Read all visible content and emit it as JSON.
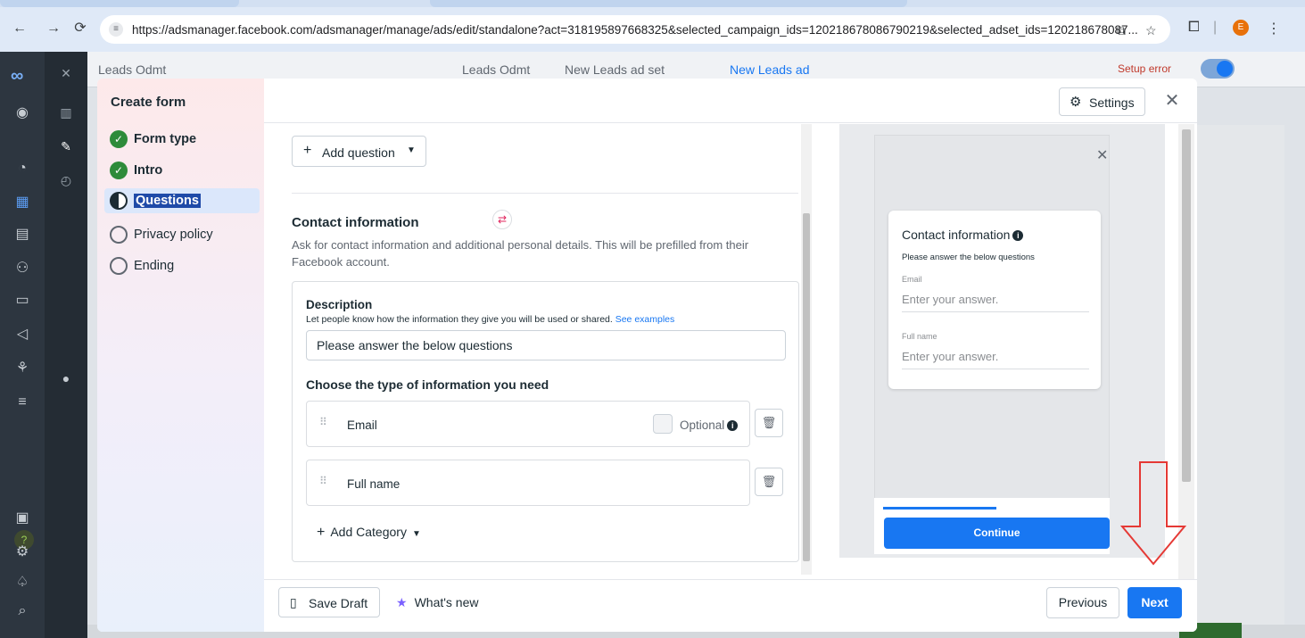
{
  "browser": {
    "url": "https://adsmanager.facebook.com/adsmanager/manage/ads/edit/standalone?act=318195897668325&selected_campaign_ids=120218678086790219&selected_adset_ids=120218678087...",
    "profile_initial": "E"
  },
  "background": {
    "campaign_label": "Leads Odmt",
    "breadcrumb": [
      "Leads Odmt",
      "New Leads ad set",
      "New Leads ad"
    ],
    "setup_status": "Setup error"
  },
  "steps_panel": {
    "title": "Create form",
    "steps": [
      {
        "label": "Form type",
        "state": "done"
      },
      {
        "label": "Intro",
        "state": "done"
      },
      {
        "label": "Questions",
        "state": "active"
      },
      {
        "label": "Privacy policy",
        "state": "todo"
      },
      {
        "label": "Ending",
        "state": "todo"
      }
    ]
  },
  "header": {
    "settings_label": "Settings",
    "close_symbol": "✕"
  },
  "form": {
    "add_question_label": "Add question",
    "section_title": "Contact information",
    "section_description": "Ask for contact information and additional personal details. This will be prefilled from their Facebook account.",
    "description_label": "Description",
    "description_help": "Let people know how the information they give you will be used or shared.",
    "description_help_link": "See examples",
    "description_value": "Please answer the below questions",
    "choose_label": "Choose the type of information you need",
    "fields": [
      {
        "name": "Email",
        "optional_label": "Optional"
      },
      {
        "name": "Full name"
      }
    ],
    "add_category_label": "Add Category"
  },
  "preview": {
    "title": "Contact information",
    "subtitle": "Please answer the below questions",
    "fields": [
      {
        "label": "Email",
        "placeholder": "Enter your answer."
      },
      {
        "label": "Full name",
        "placeholder": "Enter your answer."
      }
    ],
    "continue_label": "Continue",
    "progress": 0.5
  },
  "footer": {
    "save_draft_label": "Save Draft",
    "whats_new_label": "What's new",
    "previous_label": "Previous",
    "next_label": "Next"
  },
  "colors": {
    "accent": "#1877f2",
    "done": "#2e8b3a",
    "annotation_arrow": "#e53935"
  },
  "icons": [
    "back-arrow-icon",
    "forward-arrow-icon",
    "reload-icon",
    "meta-logo-icon",
    "gear-icon",
    "close-icon",
    "drag-handle-icon",
    "trash-icon",
    "info-icon",
    "sync-icon",
    "save-icon",
    "star-icon"
  ]
}
